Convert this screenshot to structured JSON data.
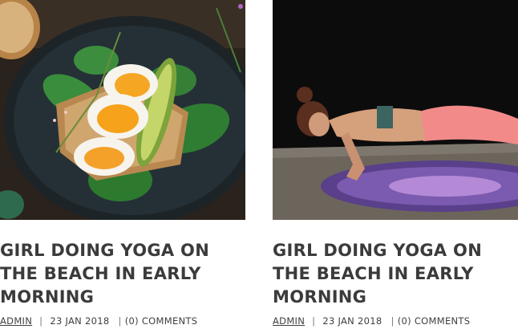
{
  "posts": [
    {
      "title_line1": "GIRL DOING YOGA ON",
      "title_line2": "THE BEACH IN EARLY",
      "title_line3": "MORNING",
      "author": "ADMIN",
      "separator": "|",
      "date": "23 JAN 2018",
      "comments": "(0) COMMENTS",
      "image_subject": "egg-avocado-toast-photo"
    },
    {
      "title_line1": "GIRL DOING YOGA ON",
      "title_line2": "THE BEACH IN EARLY",
      "title_line3": "MORNING",
      "author": "ADMIN",
      "separator": "|",
      "date": "23 JAN 2018",
      "comments": "(0) COMMENTS",
      "image_subject": "woman-yoga-pushup-photo"
    }
  ]
}
